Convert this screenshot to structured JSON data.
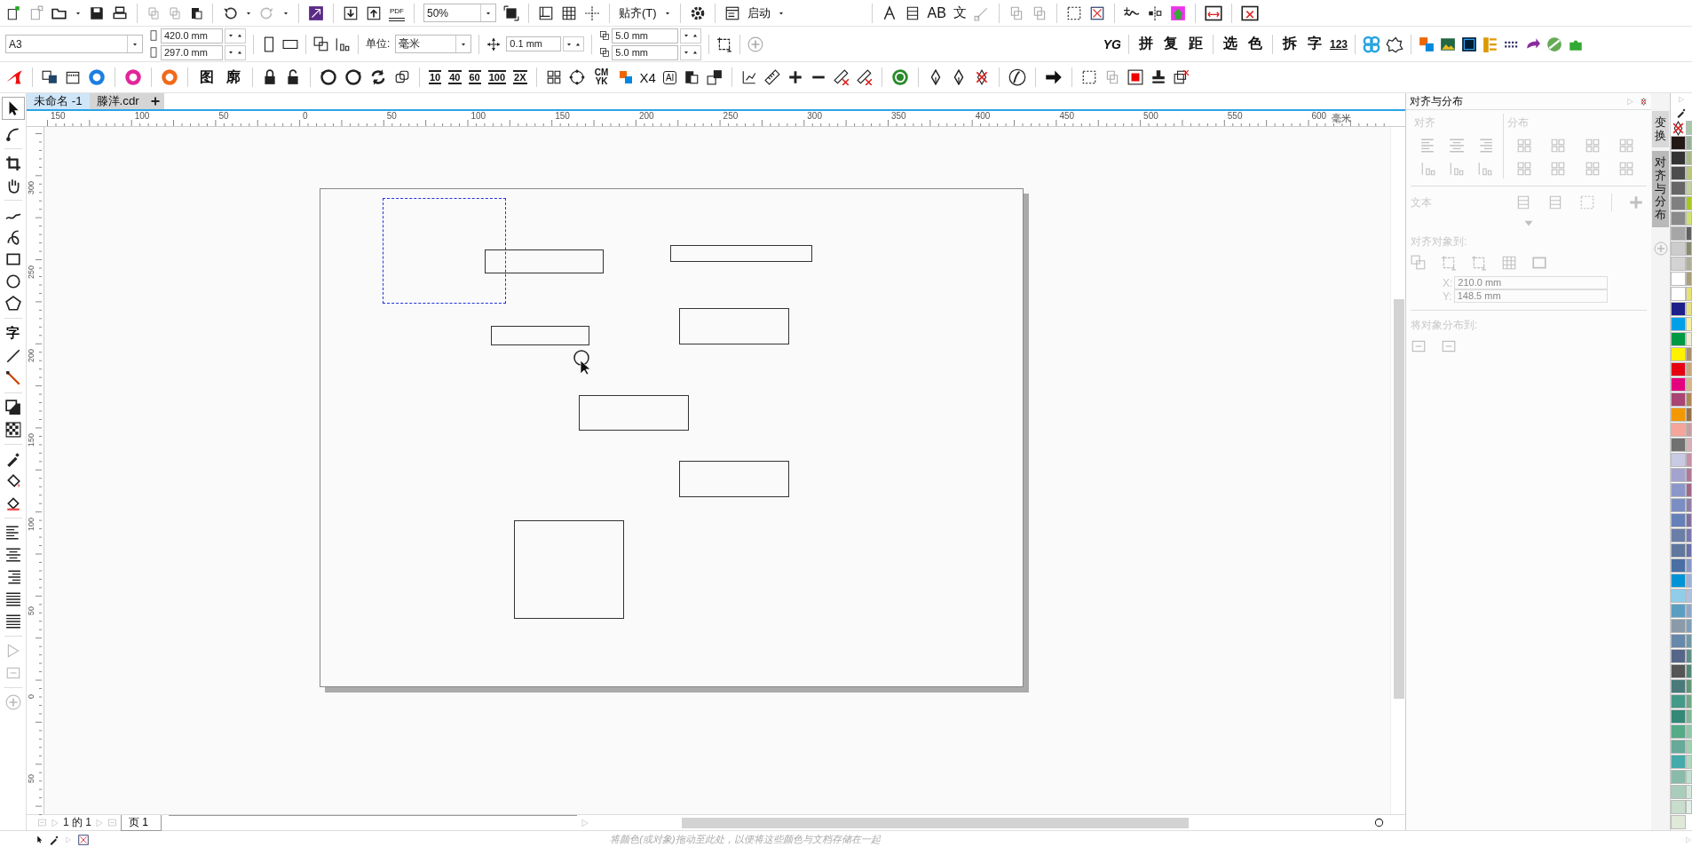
{
  "toolbar": {
    "pdf_label": "PDF",
    "zoom": "50%",
    "snap_menu": "贴齐(T)",
    "launch_menu": "启动",
    "text_tools": [
      "AB",
      "文"
    ]
  },
  "property_bar": {
    "page_size": "A3",
    "width": "420.0 mm",
    "height": "297.0 mm",
    "units_label": "单位:",
    "units": "毫米",
    "nudge": "0.1 mm",
    "dup_x": "5.0 mm",
    "dup_y": "5.0 mm",
    "macro_buttons": [
      "YG",
      "拼",
      "复",
      "距",
      "选",
      "色",
      "拆",
      "字",
      "123"
    ]
  },
  "toolbar3": {
    "char_buttons": [
      "图",
      "廓"
    ],
    "presets": [
      "10",
      "40",
      "60",
      "100",
      "2X"
    ],
    "mode_buttons": [
      "CM YK",
      "X4",
      "AI"
    ]
  },
  "toolbox": {
    "text_tool": "字"
  },
  "doc_tabs": [
    {
      "label": "未命名 -1",
      "selected": true
    },
    {
      "label": "滕洋.cdr",
      "selected": false
    }
  ],
  "ruler": {
    "h_labels": [
      "150",
      "100",
      "50",
      "0",
      "50",
      "100",
      "150",
      "200",
      "250",
      "300",
      "350",
      "400",
      "450",
      "500",
      "550",
      "600"
    ],
    "unit": "毫米",
    "v_labels": [
      "300",
      "250",
      "200",
      "150",
      "100",
      "50",
      "0",
      "50"
    ]
  },
  "docker": {
    "title": "对齐与分布",
    "disabled": true,
    "align_label": "对齐",
    "distribute_label": "分布",
    "text_label": "文本",
    "align_to_label": "对齐对象到:",
    "x_label": "X:",
    "x_value": "210.0 mm",
    "y_label": "Y:",
    "y_value": "148.5 mm",
    "distribute_to_label": "将对象分布到:"
  },
  "dock_tabs": [
    {
      "label": "变换",
      "selected": false
    },
    {
      "label": "对齐与分布",
      "selected": true
    }
  ],
  "palette": {
    "col1": [
      {
        "color": "#231815"
      },
      {
        "color": "#333333"
      },
      {
        "color": "#4d4d4d"
      },
      {
        "color": "#666666"
      },
      {
        "color": "#808080"
      },
      {
        "color": "#8a8a8a"
      },
      {
        "color": "#a6a6a6"
      },
      {
        "color": "#cccccc"
      },
      {
        "color": "#d3d3d3"
      },
      {
        "color": "#ffffff"
      },
      {
        "color": "#fefefe"
      },
      {
        "color": "#1d2088"
      },
      {
        "color": "#00a0e9"
      },
      {
        "color": "#009944"
      },
      {
        "color": "#fff100"
      },
      {
        "color": "#e60012"
      },
      {
        "color": "#e4007f"
      },
      {
        "color": "#a84573"
      },
      {
        "color": "#f39800"
      },
      {
        "color": "#f5a59a"
      },
      {
        "color": "#727171"
      },
      {
        "color": "#c8c9e3"
      },
      {
        "color": "#a3a3cf"
      },
      {
        "color": "#8c97c9"
      },
      {
        "color": "#7b8ec4"
      },
      {
        "color": "#6680b8"
      },
      {
        "color": "#6b7ea8"
      },
      {
        "color": "#60789e"
      },
      {
        "color": "#4a6fa5"
      },
      {
        "color": "#0094d6"
      },
      {
        "color": "#8fcde8"
      },
      {
        "color": "#5a9fc2"
      },
      {
        "color": "#8a9aa8"
      },
      {
        "color": "#6688aa"
      },
      {
        "color": "#556688"
      },
      {
        "color": "#555555"
      },
      {
        "color": "#4a7a7a"
      },
      {
        "color": "#449988"
      },
      {
        "color": "#338877"
      },
      {
        "color": "#55aa88"
      },
      {
        "color": "#66aa99"
      },
      {
        "color": "#44aaaa"
      },
      {
        "color": "#88bbaa"
      },
      {
        "color": "#aaccbb"
      },
      {
        "color": "#c8ddcc"
      },
      {
        "color": "#e0e8d8"
      }
    ],
    "col2": [
      {
        "color": "#a8c8a8"
      },
      {
        "color": "#98b098"
      },
      {
        "color": "#a8b888"
      },
      {
        "color": "#b8c878"
      },
      {
        "color": "#c0d0a0"
      },
      {
        "color": "#a8c820"
      },
      {
        "color": "#d0e070"
      },
      {
        "color": "#606060"
      },
      {
        "color": "#8a8a70"
      },
      {
        "color": "#b0b098"
      },
      {
        "color": "#a8a078"
      },
      {
        "color": "#e8e070"
      },
      {
        "color": "#e8e080"
      },
      {
        "color": "#f8f0a0"
      },
      {
        "color": "#f0ecd0"
      },
      {
        "color": "#a89070"
      },
      {
        "color": "#c8a878"
      },
      {
        "color": "#d8b888"
      },
      {
        "color": "#b08858"
      },
      {
        "color": "#987048"
      },
      {
        "color": "#c8a0a0"
      },
      {
        "color": "#d8b0b8"
      },
      {
        "color": "#c890a8"
      },
      {
        "color": "#b07898"
      },
      {
        "color": "#a06888"
      },
      {
        "color": "#9080a8"
      },
      {
        "color": "#8070a0"
      },
      {
        "color": "#7878b0"
      },
      {
        "color": "#6870a8"
      },
      {
        "color": "#8898c8"
      },
      {
        "color": "#a0b0d8"
      },
      {
        "color": "#b0c0e0"
      },
      {
        "color": "#90a8c8"
      },
      {
        "color": "#80a0b8"
      },
      {
        "color": "#7098a8"
      },
      {
        "color": "#609088"
      },
      {
        "color": "#508878"
      },
      {
        "color": "#609878"
      },
      {
        "color": "#70a888"
      },
      {
        "color": "#80b898"
      },
      {
        "color": "#90c8a8"
      },
      {
        "color": "#a0d0b0"
      },
      {
        "color": "#b0d8c0"
      },
      {
        "color": "#c0e0d0"
      },
      {
        "color": "#d0e8d8"
      },
      {
        "color": "#e0f0e8"
      }
    ]
  },
  "page_nav": {
    "counter": "1 的 1",
    "page_tab": "页 1"
  },
  "status": {
    "hint": "将颜色(或对象)拖动至此处，以便将这些颜色与文档存储在一起"
  }
}
